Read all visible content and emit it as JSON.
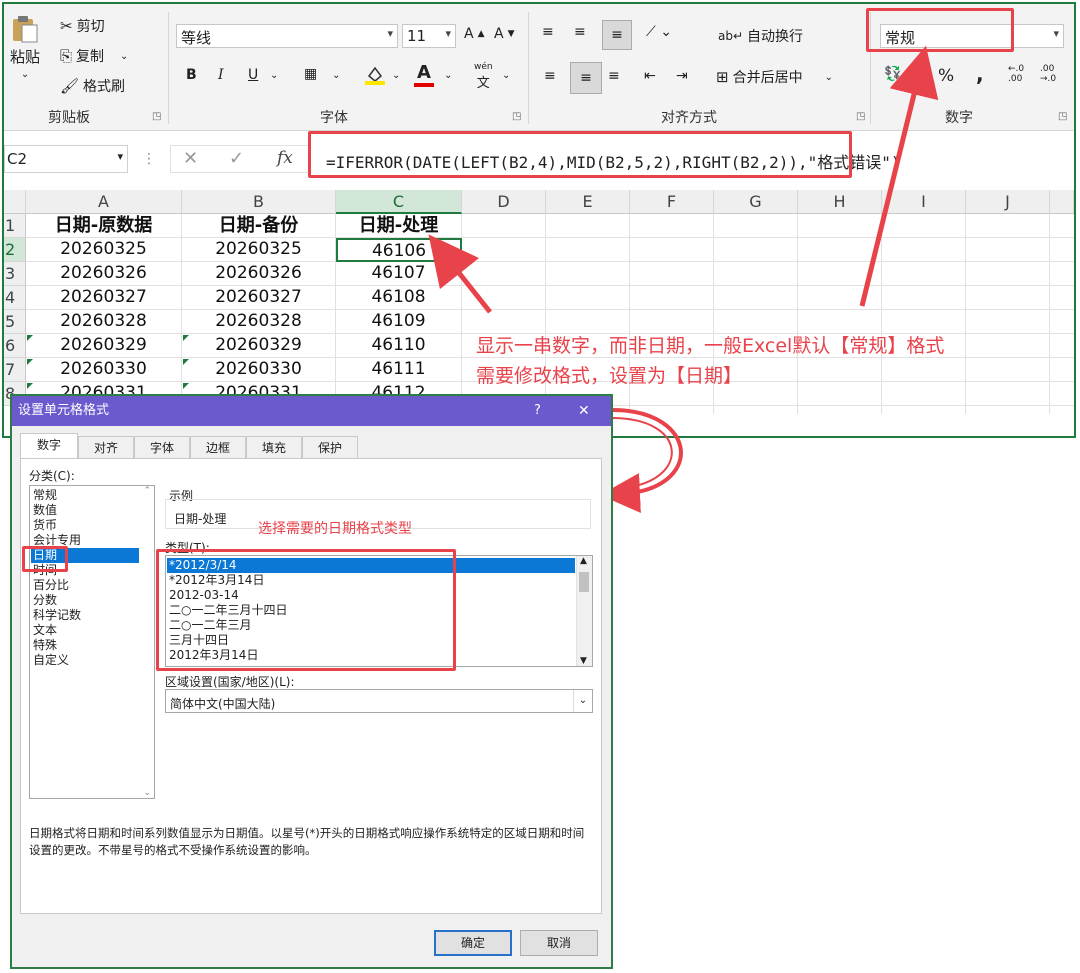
{
  "ribbon": {
    "clipboard": {
      "paste": "粘贴",
      "cut": "剪切",
      "copy": "复制",
      "format_painter": "格式刷",
      "group_label": "剪贴板"
    },
    "font": {
      "font_name": "等线",
      "font_size": "11",
      "bold": "B",
      "italic": "I",
      "underline": "U",
      "font_color_glyph": "A",
      "wen": "wén",
      "wen_char": "文",
      "group_label": "字体"
    },
    "alignment": {
      "wrap_text": "自动换行",
      "merge_center": "合并后居中",
      "group_label": "对齐方式"
    },
    "number": {
      "format": "常规",
      "percent": "%",
      "comma": ",",
      "inc_decimal": "←.0\n.00",
      "dec_decimal": ".00\n→.0",
      "group_label": "数字"
    }
  },
  "formula_bar": {
    "name_box": "C2",
    "fx": "fx",
    "formula": "=IFERROR(DATE(LEFT(B2,4),MID(B2,5,2),RIGHT(B2,2)),\"格式错误\")"
  },
  "sheet": {
    "columns": [
      "A",
      "B",
      "C",
      "D",
      "E",
      "F",
      "G",
      "H",
      "I",
      "J"
    ],
    "rows": [
      "1",
      "2",
      "3",
      "4",
      "5",
      "6",
      "7",
      "8"
    ],
    "headers": [
      "日期-原数据",
      "日期-备份",
      "日期-处理"
    ],
    "data": [
      [
        "20260325",
        "20260325",
        "46106"
      ],
      [
        "20260326",
        "20260326",
        "46107"
      ],
      [
        "20260327",
        "20260327",
        "46108"
      ],
      [
        "20260328",
        "20260328",
        "46109"
      ],
      [
        "20260329",
        "20260329",
        "46110"
      ],
      [
        "20260330",
        "20260330",
        "46111"
      ],
      [
        "20260331",
        "20260331",
        "46112"
      ]
    ]
  },
  "annotations": {
    "main_line1": "显示一串数字，而非日期，一般Excel默认【常规】格式",
    "main_line2": "需要修改格式，设置为【日期】",
    "dialog_hint": "选择需要的日期格式类型"
  },
  "dialog": {
    "title": "设置单元格格式",
    "help": "?",
    "close": "✕",
    "tabs": [
      "数字",
      "对齐",
      "字体",
      "边框",
      "填充",
      "保护"
    ],
    "category_label": "分类(C):",
    "categories": [
      "常规",
      "数值",
      "货币",
      "会计专用",
      "日期",
      "时间",
      "百分比",
      "分数",
      "科学记数",
      "文本",
      "特殊",
      "自定义"
    ],
    "selected_category": "日期",
    "sample_label": "示例",
    "sample_value": "日期-处理",
    "type_label": "类型(T):",
    "types": [
      "*2012/3/14",
      "*2012年3月14日",
      "2012-03-14",
      "二○一二年三月十四日",
      "二○一二年三月",
      "三月十四日",
      "2012年3月14日"
    ],
    "locale_label": "区域设置(国家/地区)(L):",
    "locale_value": "简体中文(中国大陆)",
    "description": "日期格式将日期和时间系列数值显示为日期值。以星号(*)开头的日期格式响应操作系统特定的区域日期和时间设置的更改。不带星号的格式不受操作系统设置的影响。",
    "ok": "确定",
    "cancel": "取消"
  },
  "colors": {
    "accent_red": "#e8424a",
    "excel_green": "#1f7a3f",
    "dialog_title": "#6a5acd",
    "selection_blue": "#0a78d4"
  }
}
